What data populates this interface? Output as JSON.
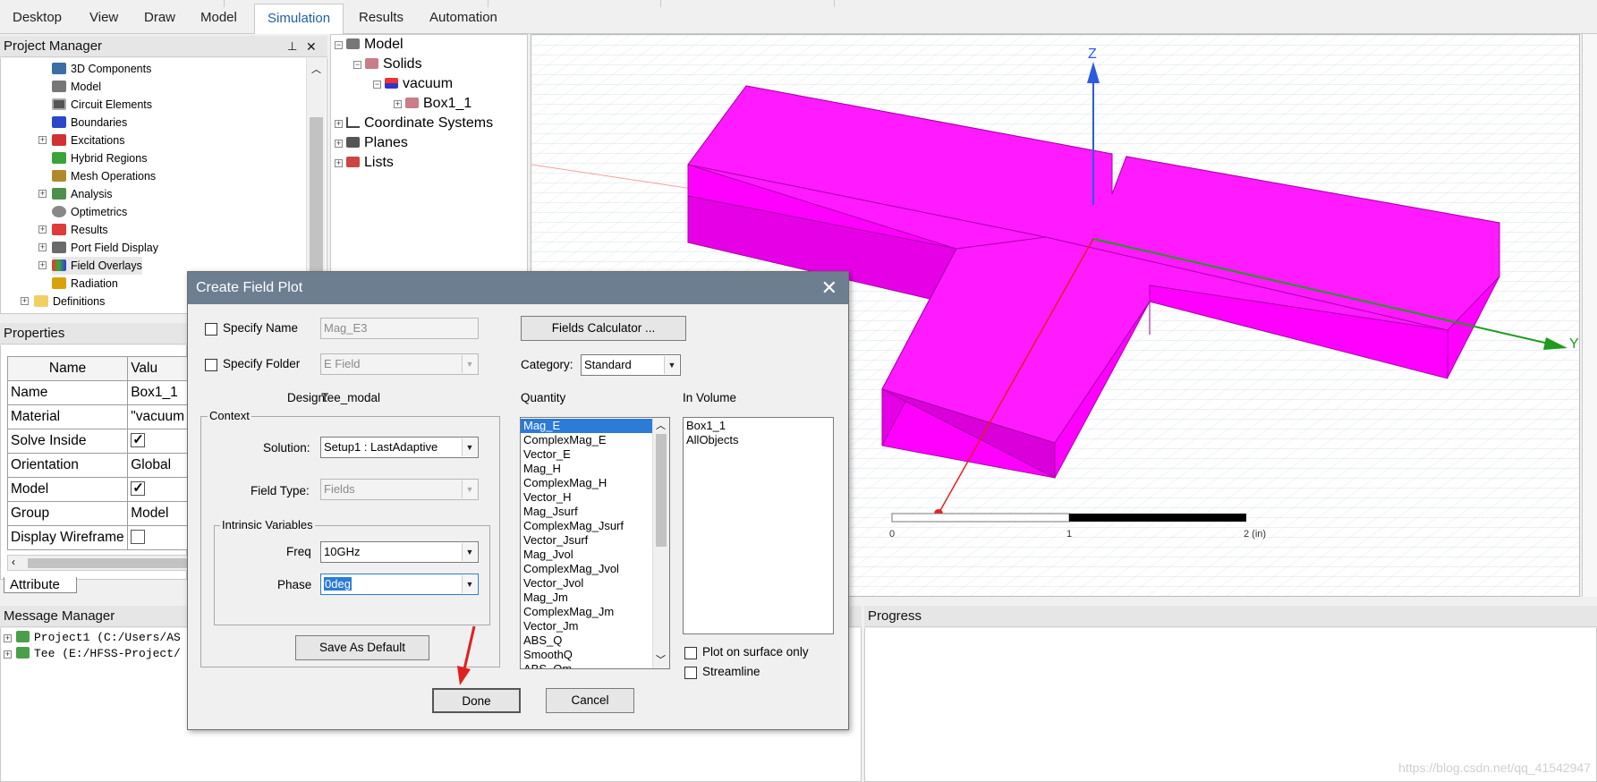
{
  "menu": {
    "tabs": [
      "Desktop",
      "View",
      "Draw",
      "Model",
      "Simulation",
      "Results",
      "Automation"
    ],
    "active": "Simulation"
  },
  "project_manager": {
    "title": "Project Manager",
    "items": [
      "3D Components",
      "Model",
      "Circuit Elements",
      "Boundaries",
      "Excitations",
      "Hybrid Regions",
      "Mesh Operations",
      "Analysis",
      "Optimetrics",
      "Results",
      "Port Field Display",
      "Field Overlays",
      "Radiation",
      "Definitions"
    ]
  },
  "model_tree": {
    "items": [
      "Model",
      "Solids",
      "vacuum",
      "Box1_1",
      "Coordinate Systems",
      "Planes",
      "Lists"
    ]
  },
  "properties": {
    "title": "Properties",
    "col_name": "Name",
    "col_value": "Valu",
    "rows": [
      {
        "name": "Name",
        "value": "Box1_1"
      },
      {
        "name": "Material",
        "value": "\"vacuum"
      },
      {
        "name": "Solve Inside",
        "value": ""
      },
      {
        "name": "Orientation",
        "value": "Global"
      },
      {
        "name": "Model",
        "value": ""
      },
      {
        "name": "Group",
        "value": "Model"
      },
      {
        "name": "Display Wireframe",
        "value": ""
      }
    ],
    "tab": "Attribute"
  },
  "message_manager": {
    "title": "Message Manager",
    "items": [
      "Project1 (C:/Users/AS",
      "Tee (E:/HFSS-Project/"
    ]
  },
  "progress": {
    "title": "Progress"
  },
  "viewport": {
    "axes": {
      "z": "Z",
      "y": "Y"
    },
    "scale": {
      "tick0": "0",
      "tick1": "1",
      "tick2": "2 (in)"
    },
    "shape_color": "#ff00ff",
    "watermark": "https://blog.csdn.net/qq_41542947"
  },
  "dialog": {
    "title": "Create Field Plot",
    "specify_name_label": "Specify Name",
    "specify_name_value": "Mag_E3",
    "specify_folder_label": "Specify Folder",
    "specify_folder_value": "E Field",
    "design_label": "Design:",
    "design_value": "Tee_modal",
    "context_label": "Context",
    "solution_label": "Solution:",
    "solution_value": "Setup1 : LastAdaptive",
    "field_type_label": "Field Type:",
    "field_type_value": "Fields",
    "intrinsic_label": "Intrinsic Variables",
    "freq_label": "Freq",
    "freq_value": "10GHz",
    "phase_label": "Phase",
    "phase_value": "0deg",
    "save_default": "Save As Default",
    "fields_calculator": "Fields Calculator ...",
    "category_label": "Category:",
    "category_value": "Standard",
    "quantity_label": "Quantity",
    "quantities": [
      "Mag_E",
      "ComplexMag_E",
      "Vector_E",
      "Mag_H",
      "ComplexMag_H",
      "Vector_H",
      "Mag_Jsurf",
      "ComplexMag_Jsurf",
      "Vector_Jsurf",
      "Mag_Jvol",
      "ComplexMag_Jvol",
      "Vector_Jvol",
      "Mag_Jm",
      "ComplexMag_Jm",
      "Vector_Jm",
      "ABS_Q",
      "SmoothQ",
      "ABS_Qm"
    ],
    "in_volume_label": "In Volume",
    "volumes": [
      "Box1_1",
      "AllObjects"
    ],
    "plot_surface_label": "Plot on surface only",
    "streamline_label": "Streamline",
    "done": "Done",
    "cancel": "Cancel"
  }
}
